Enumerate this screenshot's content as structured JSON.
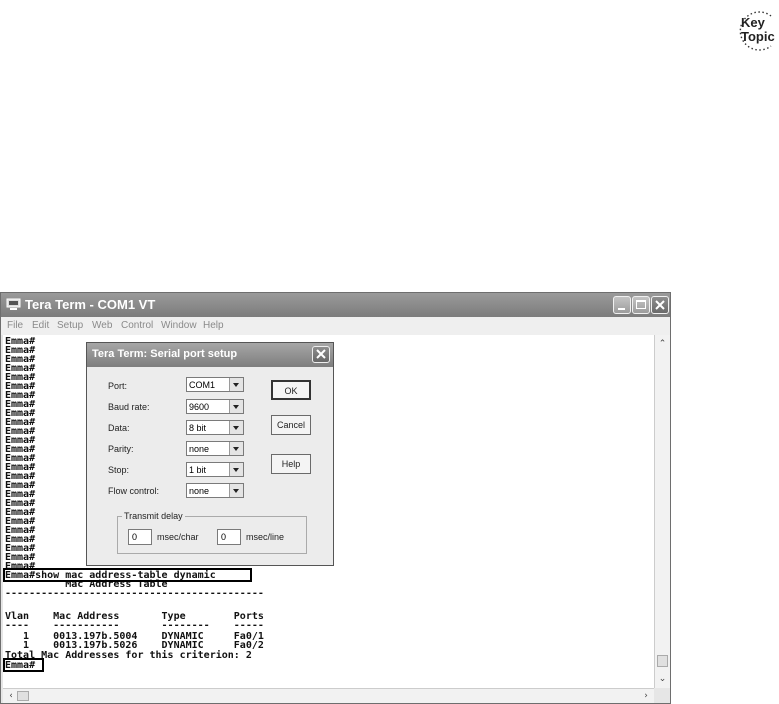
{
  "badge": {
    "line1": "Key",
    "line2": "Topic"
  },
  "window": {
    "title": "Tera Term - COM1 VT",
    "menu": [
      "File",
      "Edit",
      "Setup",
      "Web",
      "Control",
      "Window",
      "Help"
    ]
  },
  "terminal": {
    "prompt_lines": [
      "Emma#",
      "Emma#",
      "Emma#",
      "Emma#",
      "Emma#",
      "Emma#",
      "Emma#",
      "Emma#",
      "Emma#",
      "Emma#",
      "Emma#",
      "Emma#",
      "Emma#",
      "Emma#",
      "Emma#",
      "Emma#",
      "Emma#",
      "Emma#",
      "Emma#",
      "Emma#",
      "Emma#",
      "Emma#",
      "Emma#",
      "Emma#",
      "Emma#",
      "Emma#"
    ],
    "command": "Emma#show mac address-table dynamic",
    "table_title": "          Mac Address Table",
    "rule": "-------------------------------------------",
    "header": "Vlan    Mac Address       Type        Ports",
    "header_rule": "----    -----------       --------    -----",
    "rows": [
      "   1    0013.197b.5004    DYNAMIC     Fa0/1",
      "   1    0013.197b.5026    DYNAMIC     Fa0/2"
    ],
    "total": "Total Mac Addresses for this criterion: 2",
    "final_prompt": "Emma#"
  },
  "dialog": {
    "title": "Tera Term: Serial port setup",
    "port_label": "Port:",
    "port_value": "COM1",
    "baud_label": "Baud rate:",
    "baud_value": "9600",
    "data_label": "Data:",
    "data_value": "8 bit",
    "parity_label": "Parity:",
    "parity_value": "none",
    "stop_label": "Stop:",
    "stop_value": "1 bit",
    "flow_label": "Flow control:",
    "flow_value": "none",
    "ok_label": "OK",
    "cancel_label": "Cancel",
    "help_label": "Help",
    "transmit_delay_label": "Transmit delay",
    "char_delay_value": "0",
    "char_delay_unit": "msec/char",
    "line_delay_value": "0",
    "line_delay_unit": "msec/line"
  }
}
